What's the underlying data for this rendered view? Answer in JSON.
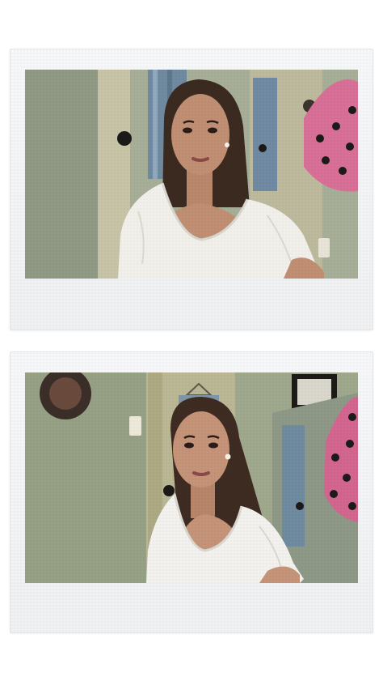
{
  "photos": [
    {
      "wall_color": "#a6ae98",
      "door_color": "#c7c4a6",
      "dress_color": "#f1efea",
      "hair_color": "#3b2a20",
      "skin_color": "#c08f73",
      "accent_bag_color": "#d86f96"
    },
    {
      "wall_color": "#9fa88c",
      "door_color": "#b9b794",
      "dress_color": "#f3f1ed",
      "hair_color": "#3e2c22",
      "skin_color": "#c49378",
      "accent_bag_color": "#d2668f"
    }
  ]
}
